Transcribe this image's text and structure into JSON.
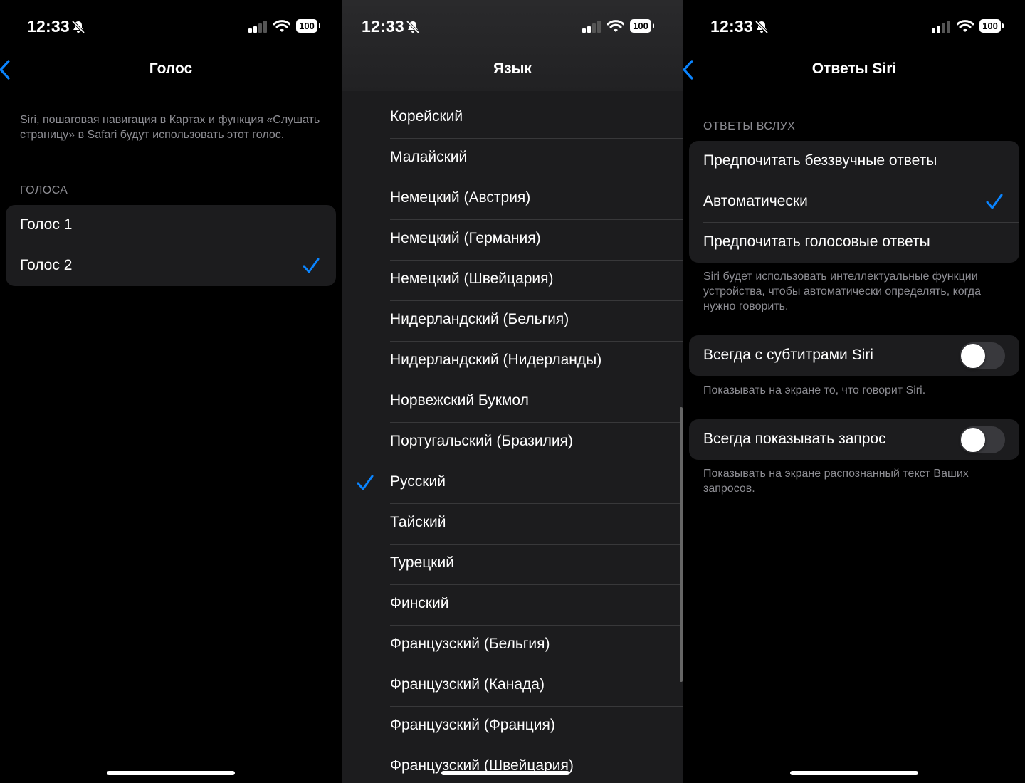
{
  "accent_color": "#0a84ff",
  "status_bar": {
    "time": "12:33",
    "battery": "100",
    "icons": [
      "bell-slash-icon",
      "cellular-signal-icon",
      "wifi-icon",
      "battery-icon"
    ]
  },
  "voice_screen": {
    "title": "Голос",
    "description": "Siri, пошаговая навигация в Картах и функция «Слушать страницу» в Safari будут использовать этот голос.",
    "section_header": "ГОЛОСА",
    "options": [
      "Голос 1",
      "Голос 2"
    ],
    "selected": "Голос 2"
  },
  "language_screen": {
    "title": "Язык",
    "languages": [
      "Корейский",
      "Малайский",
      "Немецкий (Австрия)",
      "Немецкий (Германия)",
      "Немецкий (Швейцария)",
      "Нидерландский (Бельгия)",
      "Нидерландский (Нидерланды)",
      "Норвежский Букмол",
      "Португальский (Бразилия)",
      "Русский",
      "Тайский",
      "Турецкий",
      "Финский",
      "Французский (Бельгия)",
      "Французский (Канада)",
      "Французский (Франция)",
      "Французский (Швейцария)"
    ],
    "selected": "Русский"
  },
  "siri_responses_screen": {
    "title": "Ответы Siri",
    "section_header": "ОТВЕТЫ ВСЛУХ",
    "options": [
      "Предпочитать беззвучные ответы",
      "Автоматически",
      "Предпочитать голосовые ответы"
    ],
    "selected": "Автоматически",
    "options_footer": "Siri будет использовать интеллектуальные функции устройства, чтобы автоматически определять, когда нужно говорить.",
    "captions_toggle": {
      "label": "Всегда с субтитрами Siri",
      "on": false,
      "footer": "Показывать на экране то, что говорит Siri."
    },
    "request_toggle": {
      "label": "Всегда показывать запрос",
      "on": false,
      "footer": "Показывать на экране распознанный текст Ваших запросов."
    }
  }
}
